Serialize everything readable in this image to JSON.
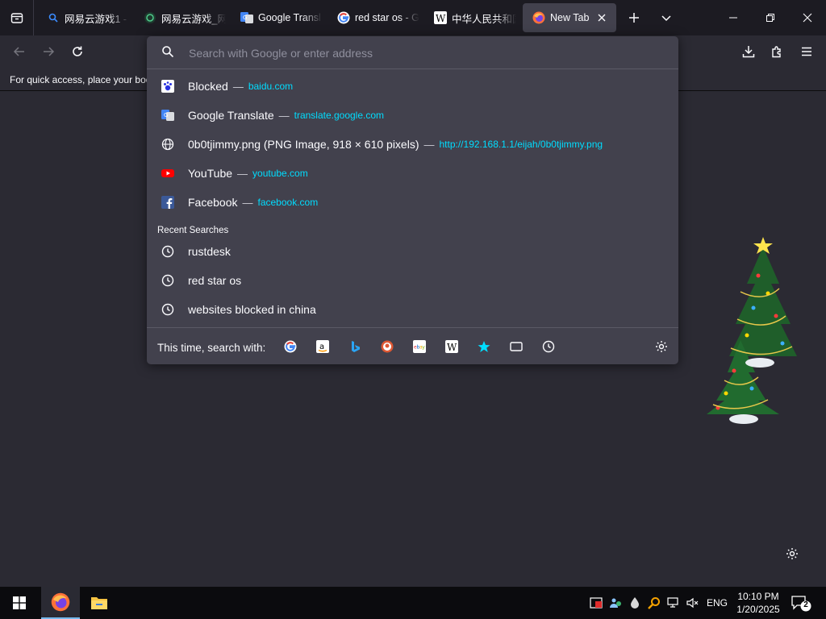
{
  "tabs": [
    {
      "title": "网易云游戏1 -",
      "icon": "search-icon"
    },
    {
      "title": "网易云游戏_网",
      "icon": "netease-icon"
    },
    {
      "title": "Google Transl",
      "icon": "google-translate-icon"
    },
    {
      "title": "red star os - G",
      "icon": "google-icon"
    },
    {
      "title": "中华人民共和国",
      "icon": "wikipedia-icon"
    },
    {
      "title": "New Tab",
      "icon": "firefox-icon",
      "active": true
    }
  ],
  "bookmarks_bar": {
    "text": "For quick access, place your boo"
  },
  "urlbar": {
    "placeholder": "Search with Google or enter address",
    "suggestions": [
      {
        "title": "Blocked",
        "url": "baidu.com",
        "icon": "baidu-icon"
      },
      {
        "title": "Google Translate",
        "url": "translate.google.com",
        "icon": "google-translate-icon"
      },
      {
        "title": "0b0tjimmy.png (PNG Image, 918 × 610 pixels)",
        "url": "http://192.168.1.1/eijah/0b0tjimmy.png",
        "icon": "globe-icon"
      },
      {
        "title": "YouTube",
        "url": "youtube.com",
        "icon": "youtube-icon"
      },
      {
        "title": "Facebook",
        "url": "facebook.com",
        "icon": "facebook-icon"
      }
    ],
    "recent_label": "Recent Searches",
    "recent": [
      "rustdesk",
      "red star os",
      "websites blocked in china"
    ],
    "separator": "—",
    "oneoff_label": "This time, search with:",
    "engines": [
      "google",
      "amazon",
      "bing",
      "duckduckgo",
      "ebay",
      "wikipedia",
      "bookmarks",
      "tabs",
      "history"
    ]
  },
  "taskbar": {
    "time": "10:10 PM",
    "date": "1/20/2025",
    "lang": "ENG",
    "notification_count": "2"
  },
  "colors": {
    "url": "#00ddff",
    "accent": "#76b9ed"
  }
}
